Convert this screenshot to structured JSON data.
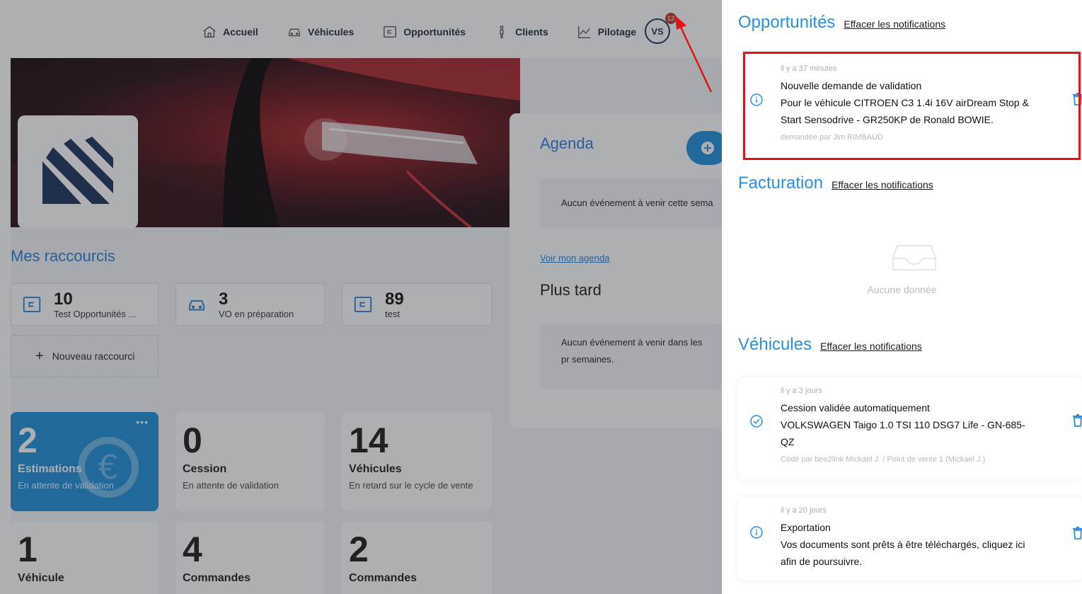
{
  "nav": {
    "items": [
      {
        "label": "Accueil",
        "icon": "home-icon"
      },
      {
        "label": "Véhicules",
        "icon": "car-icon"
      },
      {
        "label": "Opportunités",
        "icon": "wallet-icon"
      },
      {
        "label": "Clients",
        "icon": "person-icon"
      },
      {
        "label": "Pilotage",
        "icon": "chart-icon"
      }
    ],
    "avatar_initials": "VS",
    "badge_count": "12"
  },
  "shortcuts": {
    "title": "Mes raccourcis",
    "items": [
      {
        "value": "10",
        "label": "Test Opportunités ...",
        "icon": "wallet-icon"
      },
      {
        "value": "3",
        "label": "VO en préparation",
        "icon": "car-icon"
      },
      {
        "value": "89",
        "label": "test",
        "icon": "wallet-icon"
      }
    ],
    "new_label": "Nouveau raccourci"
  },
  "tiles": [
    {
      "value": "2",
      "title": "Estimations",
      "subtitle": "En attente de validation"
    },
    {
      "value": "0",
      "title": "Cession",
      "subtitle": "En attente de validation"
    },
    {
      "value": "14",
      "title": "Véhicules",
      "subtitle": "En retard sur le cycle de vente"
    },
    {
      "value": "1",
      "title": "Véhicule",
      "subtitle": ""
    },
    {
      "value": "4",
      "title": "Commandes",
      "subtitle": ""
    },
    {
      "value": "2",
      "title": "Commandes",
      "subtitle": ""
    }
  ],
  "agenda": {
    "title": "Agenda",
    "this_week_empty": "Aucun événement à venir cette sema",
    "link": "Voir mon agenda",
    "later_title": "Plus tard",
    "later_empty": "Aucun événement à venir dans les pr semaines."
  },
  "panel": {
    "opportunites": {
      "title": "Opportunités",
      "clear": "Effacer les notifications",
      "notification": {
        "time": "il y a 37 minutes",
        "title": "Nouvelle demande de validation",
        "body": "Pour le véhicule CITROEN C3 1.4i 16V airDream Stop & Start Sensodrive - GR250KP de Ronald BOWIE.",
        "meta": "demandée par Jim RIMBAUD"
      }
    },
    "facturation": {
      "title": "Facturation",
      "clear": "Effacer les notifications",
      "empty": "Aucune donnée"
    },
    "vehicules": {
      "title": "Véhicules",
      "clear": "Effacer les notifications",
      "notifications": [
        {
          "time": "il y a 3 jours",
          "title": "Cession validée automatiquement",
          "body": "VOLKSWAGEN Taigo 1.0 TSI 110 DSG7 Life - GN-685-QZ",
          "meta": "Cédé par bee2link Mickael J. / Point de vente 1 (Mickael J.)"
        },
        {
          "time": "il y a 20 jours",
          "title": "Exportation",
          "body": "Vos documents sont prêts à être téléchargés, cliquez ici afin de poursuivre.",
          "meta": ""
        }
      ]
    }
  },
  "colors": {
    "accent": "#2b8ee0",
    "highlight": "#e01414",
    "tile_blue": "#1f8fd8"
  }
}
